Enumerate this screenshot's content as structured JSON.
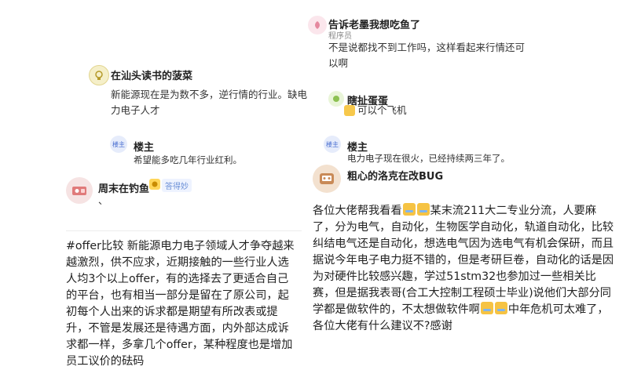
{
  "left": {
    "reply1": {
      "user": "在汕头读书的菠菜",
      "text": "新能源现在是为数不多，逆行情的行业。缺电力电子人才"
    },
    "host_reply": {
      "badge": "楼主",
      "name": "楼主",
      "text": "希望能多吃几年行业红利。"
    },
    "post": {
      "user": "周末在钓鱼",
      "badge": "答得妙",
      "sub": "、",
      "body": "#offer比较 新能源电力电子领域人才争夺越来越激烈，供不应求，近期接触的一些行业人选人均3个以上offer，有的选择去了更适合自己的平台，也有相当一部分是留在了原公司，起初每个人出来的诉求都是期望有所改表或提升，不管是发展还是待遇方面，内外部达成诉求都一样，多拿几个offer，某种程度也是增加员工议价的砝码"
    }
  },
  "right": {
    "reply1": {
      "user": "告诉老墨我想吃鱼了",
      "role": "程序员",
      "text": "不是说都找不到工作吗，这样看起来行情还可以啊"
    },
    "reply2": {
      "user": "瞎扯蛋蛋",
      "text": "可以个飞机"
    },
    "host_reply": {
      "badge": "楼主",
      "name": "楼主",
      "text": "电力电子现在很火，已经持续两三年了。"
    },
    "post": {
      "user": "粗心的洛克在改BUG",
      "body_1": "各位大佬帮我看看",
      "body_2": "某末流211大二专业分流，人要麻了，分为电气，自动化，生物医学自动化，轨道自动化，比较纠结电气还是自动化，想选电气因为选电气有机会保研，而且据说今年电子电力挺不错的，但是考研巨卷，自动化的话是因为对硬件比较感兴趣，学过51stm32也参加过一些相关比赛，但是据我表哥(合工大控制工程硕士毕业)说他们大部分同学都是做软件的，不太想做软件啊",
      "body_3": "中年危机可太难了，各位大佬有什么建议不?感谢"
    }
  }
}
